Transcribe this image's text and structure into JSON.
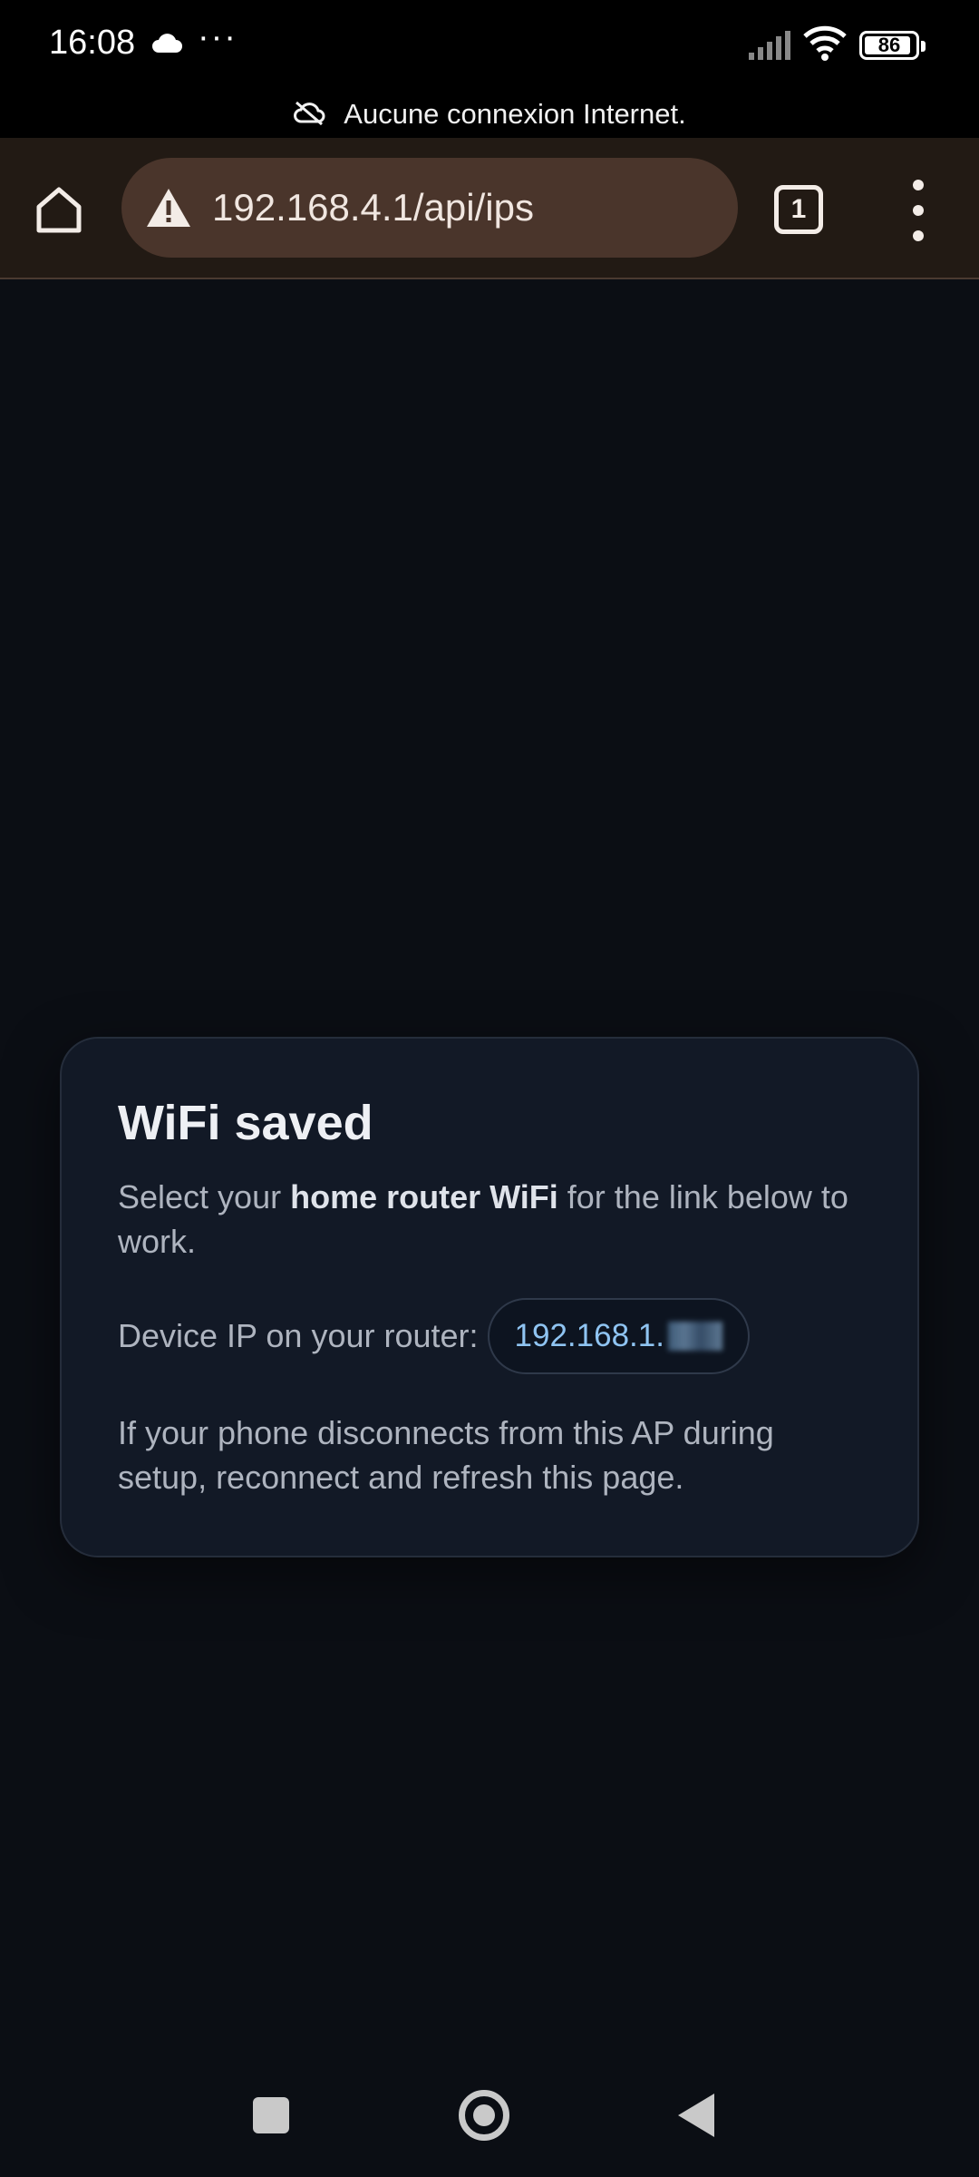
{
  "status_bar": {
    "time": "16:08",
    "overflow_dots": "···",
    "battery": "86",
    "icons": [
      "cloud-icon",
      "signal-icon",
      "wifi-icon",
      "battery-icon"
    ]
  },
  "offline_banner": {
    "text": "Aucune connexion Internet.",
    "icon": "cloud-off-icon"
  },
  "browser": {
    "url": "192.168.4.1/api/ips",
    "tab_count": "1",
    "icons": [
      "home-icon",
      "warning-icon",
      "tabs-icon",
      "more-vert-icon"
    ]
  },
  "card": {
    "title": "WiFi saved",
    "text_before": "Select your ",
    "text_bold": "home router WiFi",
    "text_after": " for the link below to work.",
    "ip_label": "Device IP on your router:",
    "ip_value": "192.168.1.",
    "note": "If your phone disconnects from this AP during setup, reconnect and refresh this page."
  },
  "nav_bar": {
    "icons": [
      "recents-icon",
      "home-circle-icon",
      "back-icon"
    ]
  },
  "colors": {
    "page_bg": "#0b0e14",
    "toolbar_bg": "#221a14",
    "url_bg": "#4a352b",
    "card_bg": "#121926",
    "ip_accent": "#8fc4f2"
  }
}
